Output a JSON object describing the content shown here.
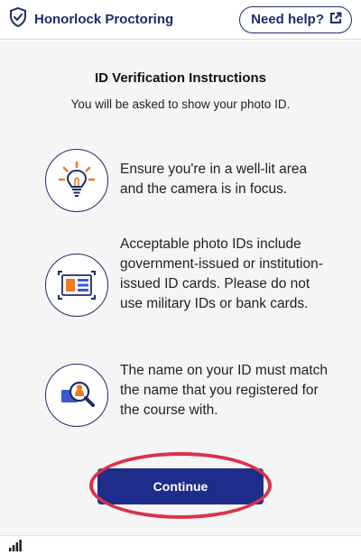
{
  "header": {
    "brand_title": "Honorlock Proctoring",
    "help_label": "Need help?"
  },
  "main": {
    "title": "ID Verification Instructions",
    "subtitle": "You will be asked to show your photo ID.",
    "items": [
      {
        "icon": "lightbulb-icon",
        "text": "Ensure you're in a well-lit area and the camera is in focus."
      },
      {
        "icon": "id-card-icon",
        "text": "Acceptable photo IDs include government-issued or institution-issued ID cards. Please do not use military IDs or bank cards."
      },
      {
        "icon": "magnifier-id-icon",
        "text": "The name on your ID must match the name that you registered for the course with."
      }
    ],
    "continue_label": "Continue"
  },
  "colors": {
    "brand": "#1e2c6b",
    "button": "#1e2c8a",
    "accent_orange": "#f07a1f",
    "highlight": "#d9334a"
  }
}
